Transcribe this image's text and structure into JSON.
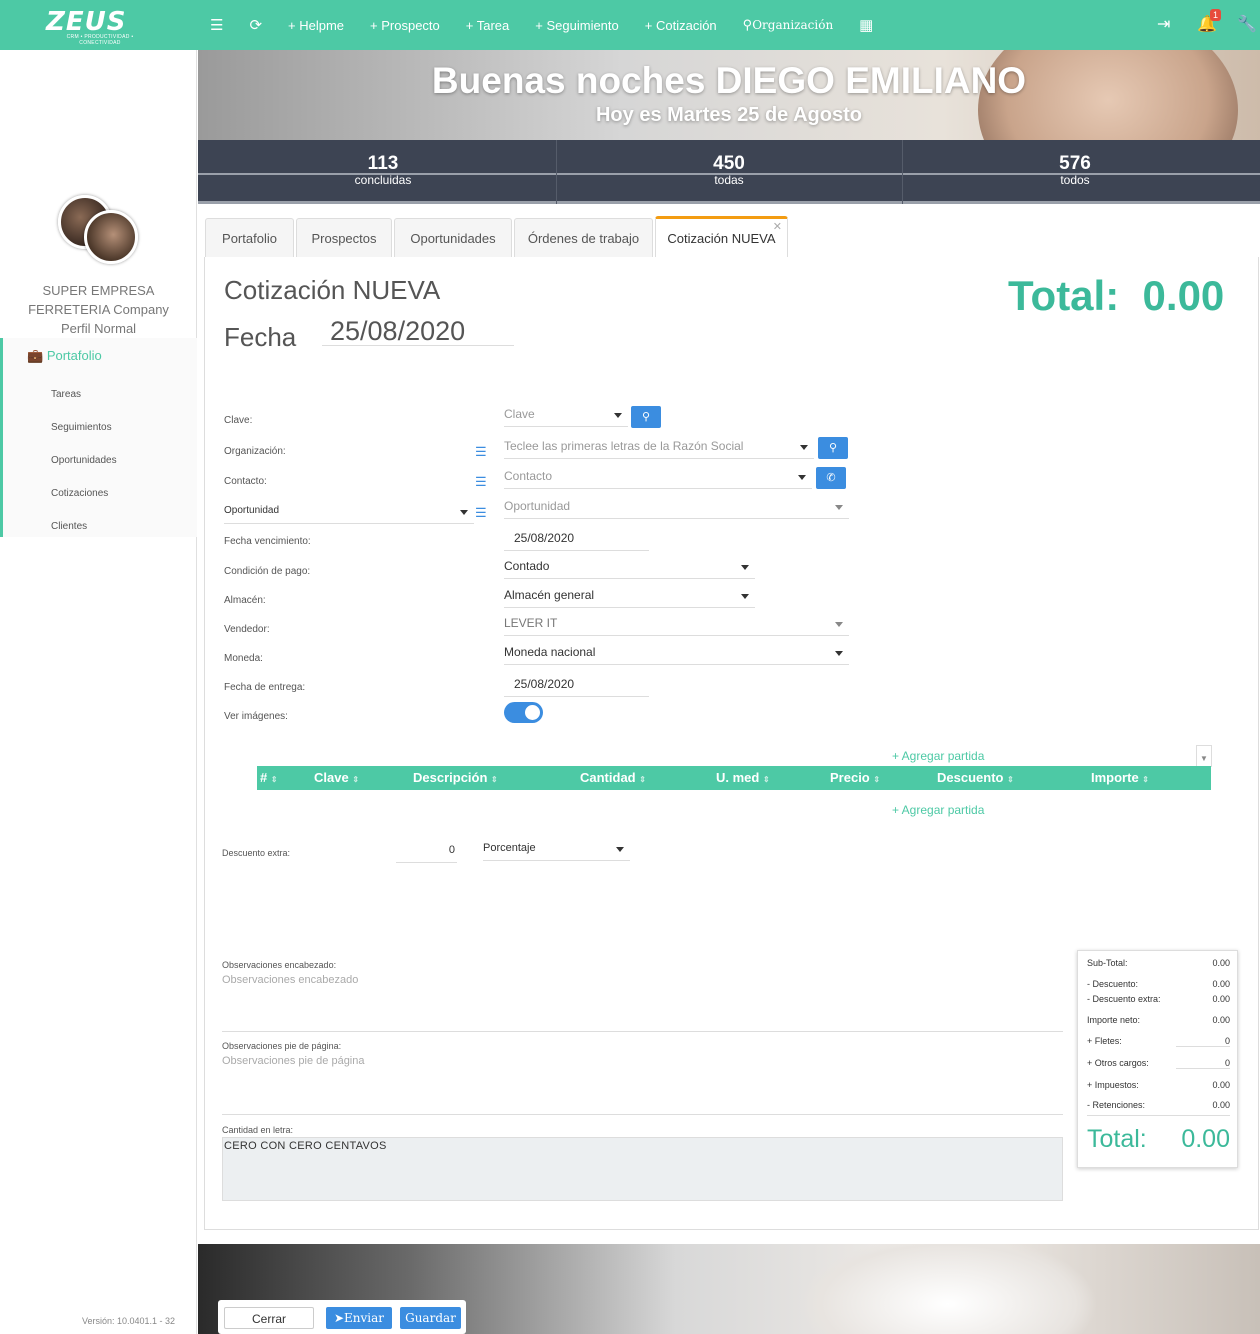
{
  "app": {
    "logo_text": "ZEUS",
    "logo_tagline": "CRM • PRODUCTIVIDAD • CONECTIVIDAD"
  },
  "nav": {
    "items": [
      "+ Helpme",
      "+ Prospecto",
      "+ Tarea",
      "+ Seguimiento",
      "+ Cotización",
      "Organización"
    ],
    "notifications": "1"
  },
  "sidebar": {
    "company_line1": "SUPER EMPRESA",
    "company_line2": "FERRETERIA Company",
    "profile": "Perfil Normal",
    "main_item": "Portafolio",
    "sub_items": [
      "Tareas",
      "Seguimientos",
      "Oportunidades",
      "Cotizaciones",
      "Clientes"
    ],
    "version": "Versión: 10.0401.1 - 32"
  },
  "hero": {
    "greeting": "Buenas noches DIEGO EMILIANO",
    "date": "Hoy es Martes 25 de Agosto"
  },
  "stats": [
    {
      "value": "113",
      "label": "concluidas"
    },
    {
      "value": "450",
      "label": "todas"
    },
    {
      "value": "576",
      "label": "todos"
    }
  ],
  "tabs": [
    "Portafolio",
    "Prospectos",
    "Oportunidades",
    "Órdenes de trabajo",
    "Cotización NUEVA"
  ],
  "form": {
    "title": "Cotización NUEVA",
    "fecha_label": "Fecha",
    "fecha": "25/08/2020",
    "total_label": "Total:",
    "total": "0.00",
    "labels": {
      "clave": "Clave:",
      "organizacion": "Organización:",
      "contacto": "Contacto:",
      "oportunidad": "Oportunidad",
      "vencimiento": "Fecha vencimiento:",
      "condicion": "Condición de pago:",
      "almacen": "Almacén:",
      "vendedor": "Vendedor:",
      "moneda": "Moneda:",
      "entrega": "Fecha de entrega:",
      "imagenes": "Ver imágenes:"
    },
    "values": {
      "clave_placeholder": "Clave",
      "org_placeholder": "Teclee las primeras letras de la Razón Social",
      "contacto_placeholder": "Contacto",
      "oportunidad_placeholder": "Oportunidad",
      "vencimiento": "25/08/2020",
      "condicion": "Contado",
      "almacen": "Almacén general",
      "vendedor": "LEVER IT",
      "moneda": "Moneda nacional",
      "entrega": "25/08/2020"
    }
  },
  "table": {
    "add_label": "+ Agregar partida",
    "columns": [
      "#",
      "Clave",
      "Descripción",
      "Cantidad",
      "U. med",
      "Precio",
      "Descuento",
      "Importe"
    ]
  },
  "descuento": {
    "label": "Descuento extra:",
    "value": "0",
    "type": "Porcentaje"
  },
  "observaciones": {
    "head_label": "Observaciones encabezado:",
    "head_placeholder": "Observaciones encabezado",
    "foot_label": "Observaciones pie de página:",
    "foot_placeholder": "Observaciones pie de página",
    "letra_label": "Cantidad en letra:",
    "letra": "CERO CON CERO CENTAVOS"
  },
  "summary": {
    "rows": [
      {
        "label": "Sub-Total:",
        "value": "0.00"
      },
      {
        "label": "- Descuento:",
        "value": "0.00"
      },
      {
        "label": "- Descuento extra:",
        "value": "0.00"
      },
      {
        "label": "Importe neto:",
        "value": "0.00"
      },
      {
        "label": "+ Fletes:",
        "value": "0"
      },
      {
        "label": "+ Otros cargos:",
        "value": "0"
      },
      {
        "label": "+ Impuestos:",
        "value": "0.00"
      },
      {
        "label": "- Retenciones:",
        "value": "0.00"
      }
    ],
    "total_label": "Total:",
    "total": "0.00"
  },
  "buttons": {
    "cerrar": "Cerrar",
    "enviar": "Enviar",
    "guardar": "Guardar"
  },
  "colors": {
    "brand": "#4dc9a5",
    "accent_blue": "#3b8de0",
    "tab_active": "#f39c12",
    "stats_bg": "#3d4453"
  }
}
